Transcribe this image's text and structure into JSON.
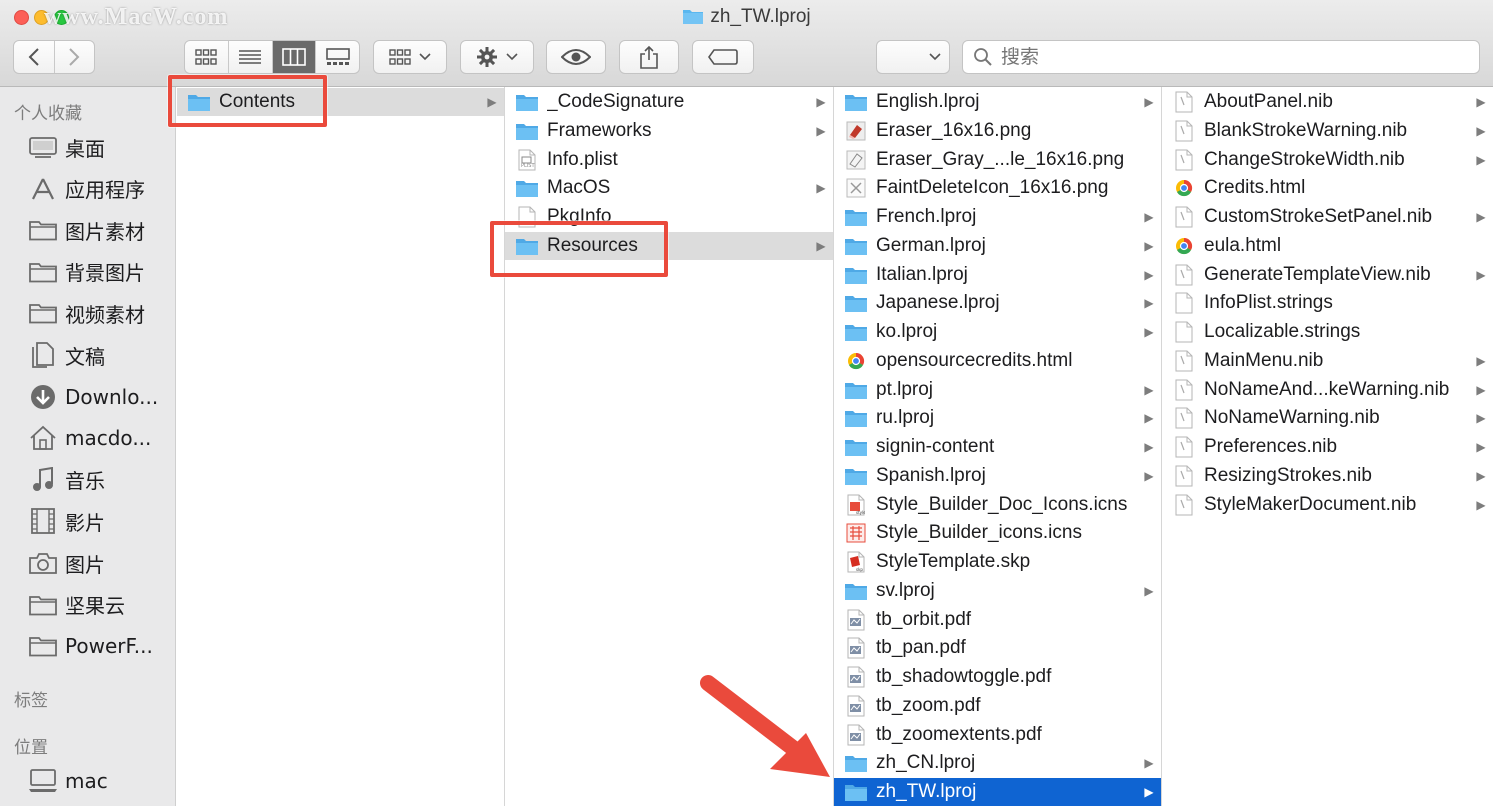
{
  "window": {
    "title": "zh_TW.lproj",
    "watermark": "www.MacW.com"
  },
  "toolbar": {
    "search_placeholder": "搜索"
  },
  "sidebar": {
    "favorites_header": "个人收藏",
    "favorites": [
      {
        "label": "桌面",
        "icon": "desktop-icon"
      },
      {
        "label": "应用程序",
        "icon": "applications-icon"
      },
      {
        "label": "图片素材",
        "icon": "folder-icon"
      },
      {
        "label": "背景图片",
        "icon": "folder-icon"
      },
      {
        "label": "视频素材",
        "icon": "folder-icon"
      },
      {
        "label": "文稿",
        "icon": "documents-icon"
      },
      {
        "label": "Downlo...",
        "icon": "downloads-icon"
      },
      {
        "label": "macdo...",
        "icon": "home-icon"
      },
      {
        "label": "音乐",
        "icon": "music-icon"
      },
      {
        "label": "影片",
        "icon": "movies-icon"
      },
      {
        "label": "图片",
        "icon": "camera-icon"
      },
      {
        "label": "坚果云",
        "icon": "folder-icon"
      },
      {
        "label": "PowerF...",
        "icon": "folder-icon"
      }
    ],
    "tags_header": "标签",
    "locations_header": "位置",
    "locations": [
      {
        "label": "mac",
        "icon": "computer-icon"
      }
    ]
  },
  "columns": [
    {
      "items": [
        {
          "name": "Contents",
          "type": "folder",
          "arrow": true,
          "selected": "gray"
        }
      ]
    },
    {
      "items": [
        {
          "name": "_CodeSignature",
          "type": "folder",
          "arrow": true
        },
        {
          "name": "Frameworks",
          "type": "folder",
          "arrow": true
        },
        {
          "name": "Info.plist",
          "type": "plist",
          "arrow": false
        },
        {
          "name": "MacOS",
          "type": "folder",
          "arrow": true
        },
        {
          "name": "PkgInfo",
          "type": "doc",
          "arrow": false
        },
        {
          "name": "Resources",
          "type": "folder",
          "arrow": true,
          "selected": "gray"
        }
      ]
    },
    {
      "items": [
        {
          "name": "English.lproj",
          "type": "folder",
          "arrow": true
        },
        {
          "name": "Eraser_16x16.png",
          "type": "png-eraser",
          "arrow": false
        },
        {
          "name": "Eraser_Gray_...le_16x16.png",
          "type": "png-gray",
          "arrow": false
        },
        {
          "name": "FaintDeleteIcon_16x16.png",
          "type": "png-x",
          "arrow": false
        },
        {
          "name": "French.lproj",
          "type": "folder",
          "arrow": true
        },
        {
          "name": "German.lproj",
          "type": "folder",
          "arrow": true
        },
        {
          "name": "Italian.lproj",
          "type": "folder",
          "arrow": true
        },
        {
          "name": "Japanese.lproj",
          "type": "folder",
          "arrow": true
        },
        {
          "name": "ko.lproj",
          "type": "folder",
          "arrow": true
        },
        {
          "name": "opensourcecredits.html",
          "type": "html",
          "arrow": false
        },
        {
          "name": "pt.lproj",
          "type": "folder",
          "arrow": true
        },
        {
          "name": "ru.lproj",
          "type": "folder",
          "arrow": true
        },
        {
          "name": "signin-content",
          "type": "folder",
          "arrow": true
        },
        {
          "name": "Spanish.lproj",
          "type": "folder",
          "arrow": true
        },
        {
          "name": "Style_Builder_Doc_Icons.icns",
          "type": "icns",
          "arrow": false
        },
        {
          "name": "Style_Builder_icons.icns",
          "type": "icns2",
          "arrow": false
        },
        {
          "name": "StyleTemplate.skp",
          "type": "skp",
          "arrow": false
        },
        {
          "name": "sv.lproj",
          "type": "folder",
          "arrow": true
        },
        {
          "name": "tb_orbit.pdf",
          "type": "pdf",
          "arrow": false
        },
        {
          "name": "tb_pan.pdf",
          "type": "pdf",
          "arrow": false
        },
        {
          "name": "tb_shadowtoggle.pdf",
          "type": "pdf",
          "arrow": false
        },
        {
          "name": "tb_zoom.pdf",
          "type": "pdf",
          "arrow": false
        },
        {
          "name": "tb_zoomextents.pdf",
          "type": "pdf",
          "arrow": false
        },
        {
          "name": "zh_CN.lproj",
          "type": "folder",
          "arrow": true
        },
        {
          "name": "zh_TW.lproj",
          "type": "folder",
          "arrow": true,
          "selected": "blue"
        }
      ]
    },
    {
      "items": [
        {
          "name": "AboutPanel.nib",
          "type": "nib",
          "arrow": true
        },
        {
          "name": "BlankStrokeWarning.nib",
          "type": "nib",
          "arrow": true
        },
        {
          "name": "ChangeStrokeWidth.nib",
          "type": "nib",
          "arrow": true
        },
        {
          "name": "Credits.html",
          "type": "html",
          "arrow": false
        },
        {
          "name": "CustomStrokeSetPanel.nib",
          "type": "nib",
          "arrow": true
        },
        {
          "name": "eula.html",
          "type": "html",
          "arrow": false
        },
        {
          "name": "GenerateTemplateView.nib",
          "type": "nib",
          "arrow": true
        },
        {
          "name": "InfoPlist.strings",
          "type": "doc",
          "arrow": false
        },
        {
          "name": "Localizable.strings",
          "type": "doc",
          "arrow": false
        },
        {
          "name": "MainMenu.nib",
          "type": "nib",
          "arrow": true
        },
        {
          "name": "NoNameAnd...keWarning.nib",
          "type": "nib",
          "arrow": true
        },
        {
          "name": "NoNameWarning.nib",
          "type": "nib",
          "arrow": true
        },
        {
          "name": "Preferences.nib",
          "type": "nib",
          "arrow": true
        },
        {
          "name": "ResizingStrokes.nib",
          "type": "nib",
          "arrow": true
        },
        {
          "name": "StyleMakerDocument.nib",
          "type": "nib",
          "arrow": true
        }
      ]
    }
  ],
  "colors": {
    "selection_blue": "#0f64d2",
    "highlight_red": "#ea4a3c",
    "folder_blue": "#5ab7ef"
  }
}
